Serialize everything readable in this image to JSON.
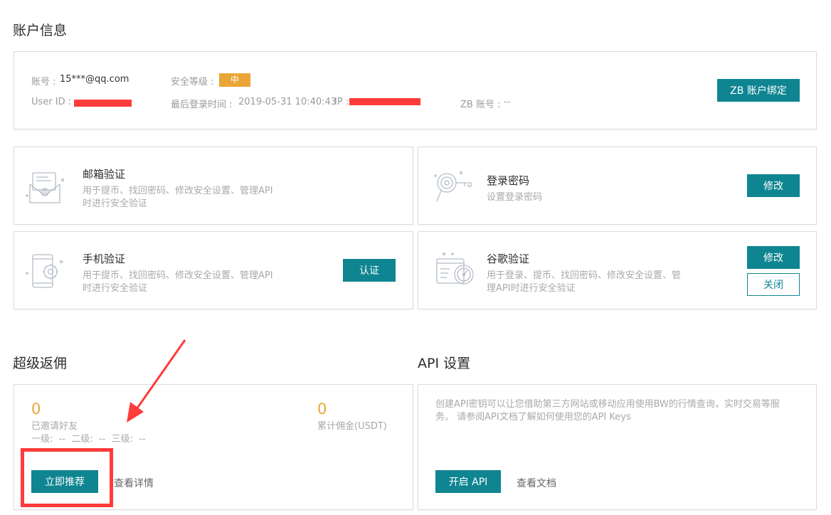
{
  "account": {
    "title": "账户信息",
    "account_label": "账号 :",
    "account_value": "15***@qq.com",
    "security_label": "安全等级 :",
    "security_level": "中",
    "userid_label": "User ID :",
    "last_login_label": "最后登录时间 :",
    "last_login_value": "2019-05-31 10:40:43",
    "ip_label": "IP :",
    "zb_label": "ZB 账号 :",
    "zb_value": "--",
    "bind_button": "ZB 账户绑定"
  },
  "email_verify": {
    "title": "邮箱验证",
    "desc_line1": "用于提币、找回密码、修改安全设置、管理API",
    "desc_line2": "时进行安全验证"
  },
  "login_password": {
    "title": "登录密码",
    "desc": "设置登录密码",
    "modify_button": "修改"
  },
  "phone_verify": {
    "title": "手机验证",
    "desc_line1": "用于提币、找回密码、修改安全设置、管理API",
    "desc_line2": "时进行安全验证",
    "verify_button": "认证"
  },
  "google_verify": {
    "title": "谷歌验证",
    "desc_line1": "用于登录、提币、找回密码、修改安全设置、管",
    "desc_line2": "理API时进行安全验证",
    "modify_button": "修改",
    "close_button": "关闭"
  },
  "rebate": {
    "title": "超级返佣",
    "invited_count": "0",
    "invited_label": "已邀请好友",
    "levels": "一级:  --  二级:  --  三级:  --",
    "commission_value": "0",
    "commission_label": "累计佣金(USDT)",
    "recommend_button": "立即推荐",
    "details_link": "查看详情"
  },
  "api": {
    "title": "API 设置",
    "desc_line1": "创建API密钥可以让您借助第三方网站或移动应用使用BW的行情查询，实时交易等服",
    "desc_line2": "务。 请参阅API文档了解如何使用您的API Keys",
    "enable_button": "开启 API",
    "docs_link": "查看文档"
  },
  "colors": {
    "accent": "#0f8591",
    "badge": "#e9a637",
    "annotation_red": "#ff3b3b"
  }
}
